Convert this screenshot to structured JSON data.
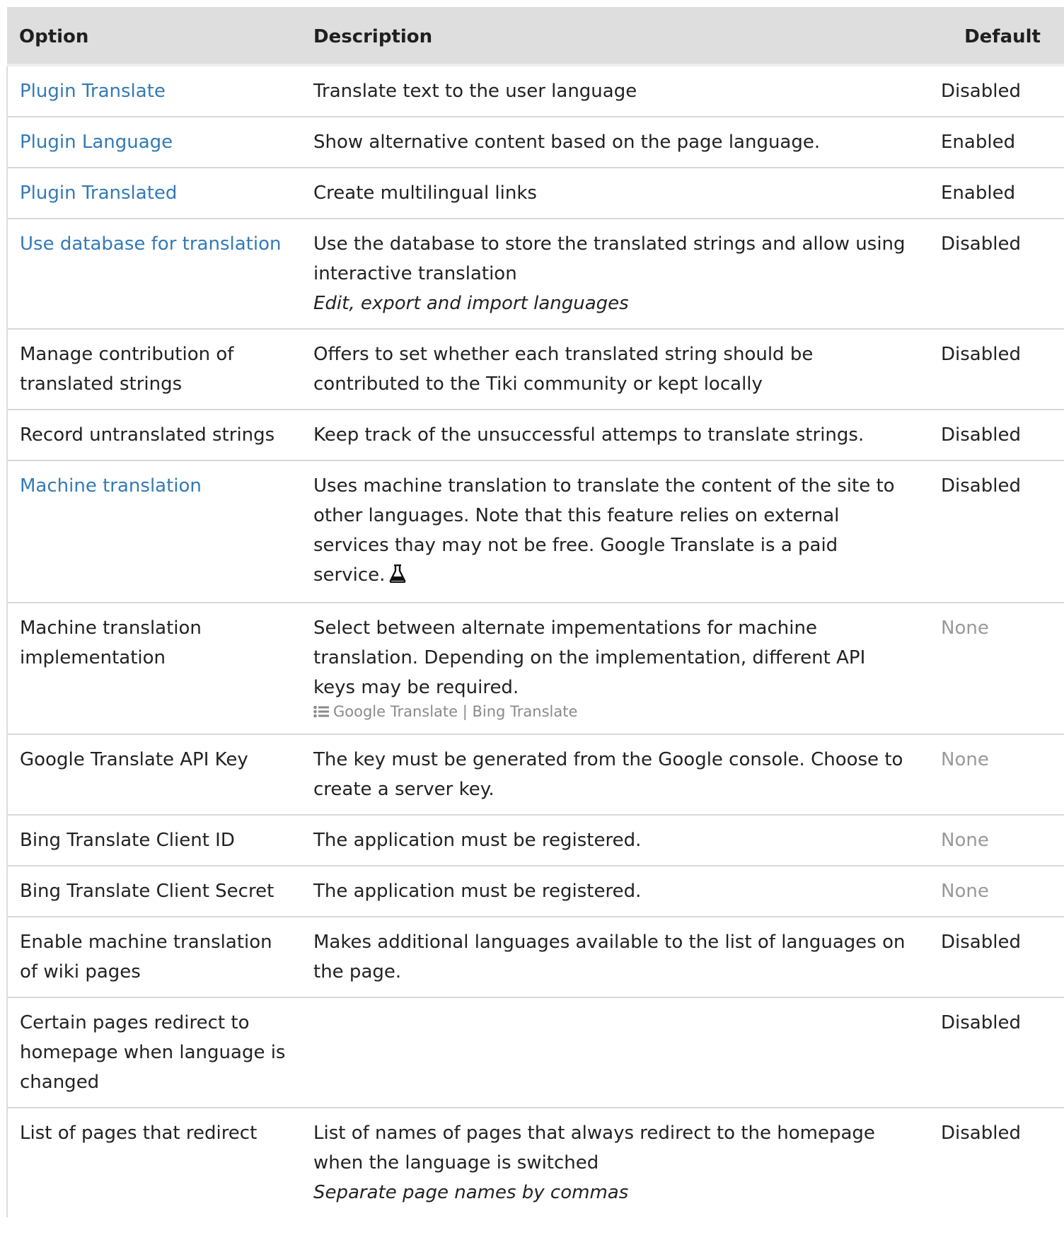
{
  "table": {
    "headers": {
      "option": "Option",
      "description": "Description",
      "default": "Default"
    },
    "rows": [
      {
        "option": "Plugin Translate",
        "option_is_link": true,
        "description": "Translate text to the user language",
        "default": "Disabled"
      },
      {
        "option": "Plugin Language",
        "option_is_link": true,
        "description": "Show alternative content based on the page language.",
        "default": "Enabled"
      },
      {
        "option": "Plugin Translated",
        "option_is_link": true,
        "description": "Create multilingual links",
        "default": "Enabled"
      },
      {
        "option": "Use database for translation",
        "option_is_link": true,
        "description": "Use the database to store the translated strings and allow using interactive translation",
        "hint": "Edit, export and import languages",
        "default": "Disabled"
      },
      {
        "option": "Manage contribution of translated strings",
        "option_is_link": false,
        "description": "Offers to set whether each translated string should be contributed to the Tiki community or kept locally",
        "default": "Disabled"
      },
      {
        "option": "Record untranslated strings",
        "option_is_link": false,
        "description": "Keep track of the unsuccessful attemps to translate strings.",
        "default": "Disabled"
      },
      {
        "option": "Machine translation",
        "option_is_link": true,
        "description": "Uses machine translation to translate the content of the site to other languages. Note that this feature relies on external services thay may not be free. Google Translate is a paid service.",
        "experimental_icon": "flask-icon",
        "default": "Disabled"
      },
      {
        "option": "Machine translation implementation",
        "option_is_link": false,
        "description": "Select between alternate impementations for machine translation. Depending on the implementation, different API keys may be required.",
        "options_list": "Google Translate | Bing Translate",
        "options_icon": "list-icon",
        "default": "None"
      },
      {
        "option": "Google Translate API Key",
        "option_is_link": false,
        "description": "The key must be generated from the Google console. Choose to create a server key.",
        "default": "None"
      },
      {
        "option": "Bing Translate Client ID",
        "option_is_link": false,
        "description": "The application must be registered.",
        "default": "None"
      },
      {
        "option": "Bing Translate Client Secret",
        "option_is_link": false,
        "description": "The application must be registered.",
        "default": "None"
      },
      {
        "option": "Enable machine translation of wiki pages",
        "option_is_link": false,
        "description": "Makes additional languages available to the list of languages on the page.",
        "default": "Disabled"
      },
      {
        "option": "Certain pages redirect to homepage when language is changed",
        "option_is_link": false,
        "description": "",
        "default": "Disabled"
      },
      {
        "option": "List of pages that redirect",
        "option_is_link": false,
        "description": "List of names of pages that always redirect to the homepage when the language is switched",
        "hint": "Separate page names by commas",
        "default": "Disabled"
      }
    ]
  },
  "colors": {
    "link": "#337ab7",
    "header_bg": "#dedede",
    "muted": "#999999",
    "border": "#d8d8d8"
  }
}
